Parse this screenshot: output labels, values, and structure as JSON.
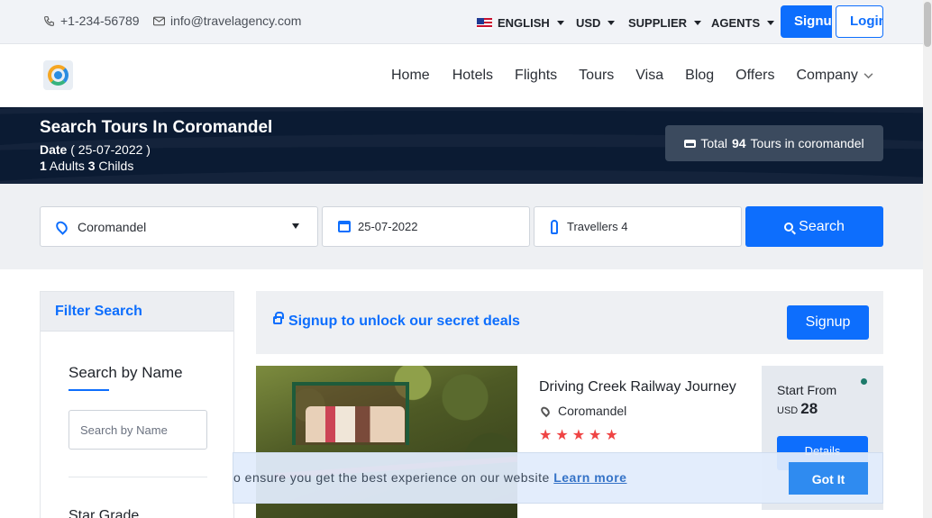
{
  "topbar": {
    "phone": "+1-234-56789",
    "email": "info@travelagency.com",
    "language": "ENGLISH",
    "currency": "USD",
    "supplier": "SUPPLIER",
    "agents": "AGENTS",
    "signup": "Signup",
    "login": "Login"
  },
  "nav": {
    "items": [
      "Home",
      "Hotels",
      "Flights",
      "Tours",
      "Visa",
      "Blog",
      "Offers",
      "Company"
    ]
  },
  "hero": {
    "title": "Search Tours In Coromandel",
    "date_label": "Date",
    "date_value": "( 25-07-2022 )",
    "adults_count": "1",
    "adults_label": "Adults",
    "childs_count": "3",
    "childs_label": "Childs",
    "total_prefix": "Total",
    "total_count": "94",
    "total_suffix": "Tours in coromandel"
  },
  "search": {
    "location": "Coromandel",
    "date": "25-07-2022",
    "travellers": "Travellers 4",
    "button": "Search"
  },
  "filter": {
    "header": "Filter Search",
    "search_by_name_title": "Search by Name",
    "search_by_name_placeholder": "Search by Name",
    "star_grade_title": "Star Grade"
  },
  "deal": {
    "text": "Signup to unlock our secret deals",
    "button": "Signup"
  },
  "tour": {
    "title": "Driving Creek Railway Journey",
    "location": "Coromandel",
    "stars": "★★★★★",
    "start_from": "Start From",
    "currency": "USD",
    "price": "28",
    "details": "Details"
  },
  "cookie": {
    "text": "o ensure you get the best experience on our website",
    "learn_more": "Learn more",
    "button": "Got It"
  },
  "colors": {
    "primary": "#0d6efd",
    "hero_bg": "#0b1b33",
    "star": "#ef4444"
  }
}
